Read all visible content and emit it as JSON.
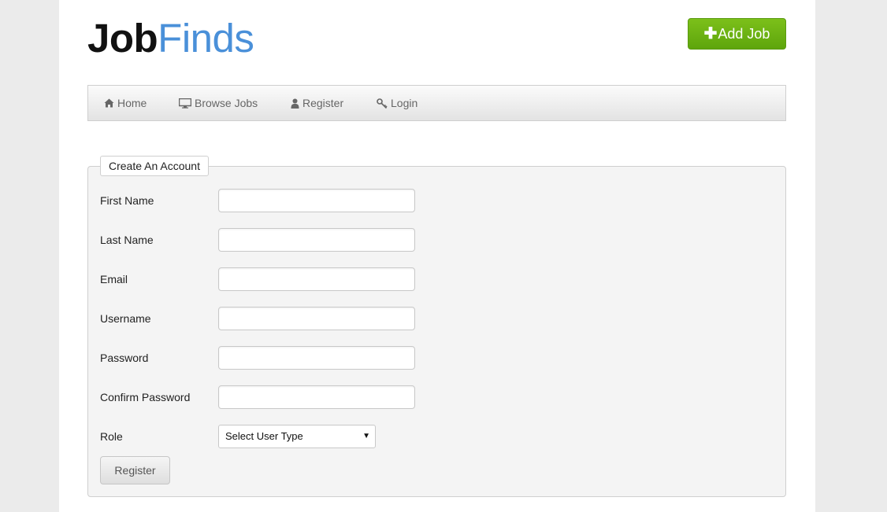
{
  "brand": {
    "part1": "Job",
    "part2": "Finds",
    "accent": "#4a90d9"
  },
  "header": {
    "add_job_label": "Add Job",
    "add_job_icon": "plus-icon",
    "add_job_color": "#6cb515"
  },
  "nav": {
    "items": [
      {
        "label": "Home",
        "icon": "home-icon"
      },
      {
        "label": "Browse Jobs",
        "icon": "monitor-icon"
      },
      {
        "label": "Register",
        "icon": "user-icon"
      },
      {
        "label": "Login",
        "icon": "key-icon"
      }
    ]
  },
  "form": {
    "legend": "Create An Account",
    "fields": [
      {
        "label": "First Name",
        "value": ""
      },
      {
        "label": "Last Name",
        "value": ""
      },
      {
        "label": "Email",
        "value": ""
      },
      {
        "label": "Username",
        "value": ""
      },
      {
        "label": "Password",
        "value": ""
      },
      {
        "label": "Confirm Password",
        "value": ""
      }
    ],
    "role": {
      "label": "Role",
      "selected": "Select User Type"
    },
    "submit_label": "Register"
  }
}
